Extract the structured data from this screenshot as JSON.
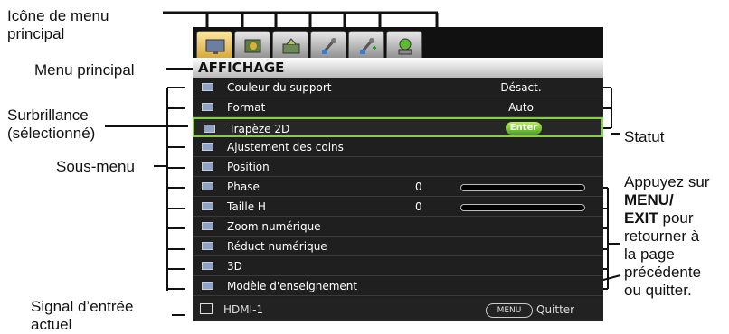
{
  "annotations": {
    "main_menu_icon": [
      "Icône de menu",
      "principal"
    ],
    "main_menu": "Menu principal",
    "highlight": [
      "Surbrillance",
      "(sélectionné)"
    ],
    "submenu": "Sous-menu",
    "current_input": [
      "Signal d’entrée",
      "actuel"
    ],
    "status": "Statut",
    "press_menu": {
      "line1": "Appuyez sur",
      "bold1": "MENU/",
      "bold2": "EXIT",
      "after_bold2": " pour",
      "line4": "retourner à",
      "line5": "la page",
      "line6": "précédente",
      "line7": "ou quitter."
    }
  },
  "osd": {
    "tabs": [
      {
        "icon": "display-icon",
        "active": true
      },
      {
        "icon": "picture-icon",
        "active": false
      },
      {
        "icon": "source-icon",
        "active": false
      },
      {
        "icon": "system-setup-basic-icon",
        "active": false
      },
      {
        "icon": "system-setup-advanced-icon",
        "active": false
      },
      {
        "icon": "information-icon",
        "active": false
      }
    ],
    "title": "AFFICHAGE",
    "items": [
      {
        "label": "Couleur du support",
        "value": "Désact."
      },
      {
        "label": "Format",
        "value": "Auto"
      },
      {
        "label": "Trapèze 2D",
        "value": "Enter",
        "selected": true
      },
      {
        "label": "Ajustement des coins",
        "value": ""
      },
      {
        "label": "Position",
        "value": ""
      },
      {
        "label": "Phase",
        "value": "0",
        "slider": true
      },
      {
        "label": "Taille H",
        "value": "0",
        "slider": true
      },
      {
        "label": "Zoom numérique",
        "value": ""
      },
      {
        "label": "Réduct numérique",
        "value": ""
      },
      {
        "label": "3D",
        "value": ""
      },
      {
        "label": "Modèle d'enseignement",
        "value": ""
      }
    ],
    "status": {
      "source": "HDMI-1",
      "menu_key": "MENU",
      "quit_label": "Quitter"
    }
  },
  "colors": {
    "highlight_border": "#7fd43a",
    "enter_button": "#4aa321",
    "panel_background": "#1f1f1f"
  }
}
